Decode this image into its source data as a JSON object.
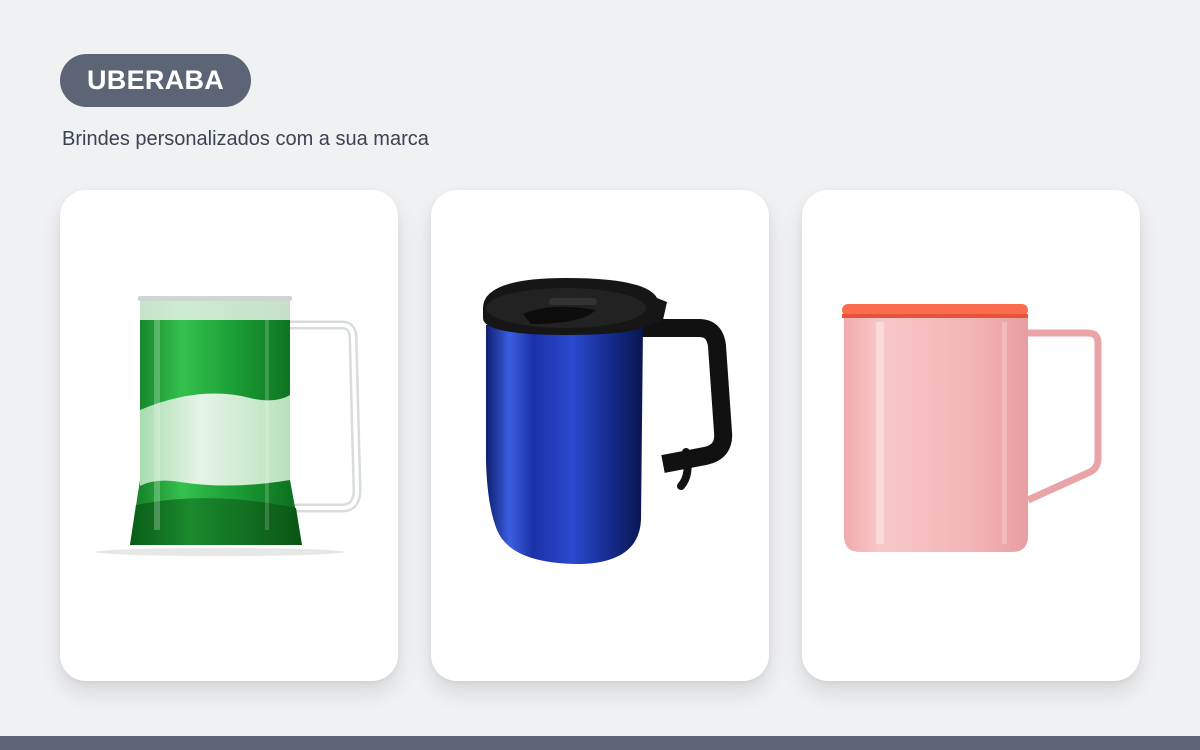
{
  "header": {
    "badge_label": "UBERABA",
    "subtitle": "Brindes personalizados com a sua marca"
  },
  "products": [
    {
      "icon": "green-gel-beer-mug-icon"
    },
    {
      "icon": "blue-thermal-mug-with-lid-icon"
    },
    {
      "icon": "pink-enamel-mug-with-orange-lid-icon"
    }
  ],
  "colors": {
    "page_background": "#f0f1f3",
    "badge_background": "#5c6575",
    "badge_text": "#ffffff",
    "subtitle_text": "#3b4252",
    "card_background": "#ffffff",
    "footer_bar": "#5c6575"
  }
}
